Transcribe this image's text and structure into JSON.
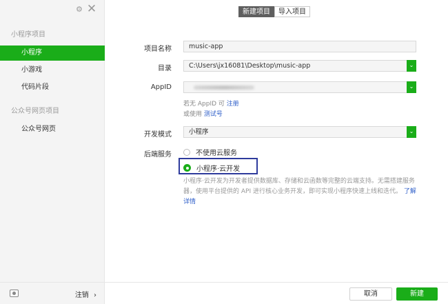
{
  "sidebar": {
    "gear_icon": "⚙",
    "close_icon": "✕",
    "group1_title": "小程序项目",
    "items": [
      {
        "label": "小程序"
      },
      {
        "label": "小游戏"
      },
      {
        "label": "代码片段"
      }
    ],
    "group2_title": "公众号网页项目",
    "group2_items": [
      {
        "label": "公众号网页"
      }
    ],
    "logout_label": "注销",
    "logout_chevron": "›"
  },
  "tabs": [
    {
      "label": "新建项目",
      "active": true
    },
    {
      "label": "导入项目",
      "active": false
    }
  ],
  "form": {
    "project_name_label": "项目名称",
    "project_name_value": "music-app",
    "directory_label": "目录",
    "directory_value": "C:\\Users\\jx16081\\Desktop\\music-app",
    "appid_label": "AppID",
    "appid_hint_prefix": "若无 AppID 可",
    "appid_hint_link": "注册",
    "appid_hint2_prefix": "或使用",
    "appid_hint2_link": "测试号",
    "dev_mode_label": "开发模式",
    "dev_mode_value": "小程序",
    "backend_label": "后端服务",
    "backend_options": [
      {
        "label": "不使用云服务",
        "checked": false
      },
      {
        "label": "小程序·云开发",
        "checked": true
      }
    ],
    "cloud_desc": "小程序·云开发为开发者提供数据库、存储和云函数等完整的云端支持。无需搭建服务器，使用平台提供的 API 进行核心业务开发，即可实现小程序快速上线和迭代。",
    "cloud_desc_link": "了解详情",
    "dropdown_icon": "⌄"
  },
  "buttons": {
    "cancel": "取消",
    "create": "新建"
  },
  "colors": {
    "accent": "#1aad19",
    "highlight_border": "#2d3a9c",
    "link": "#2f5fc9"
  }
}
